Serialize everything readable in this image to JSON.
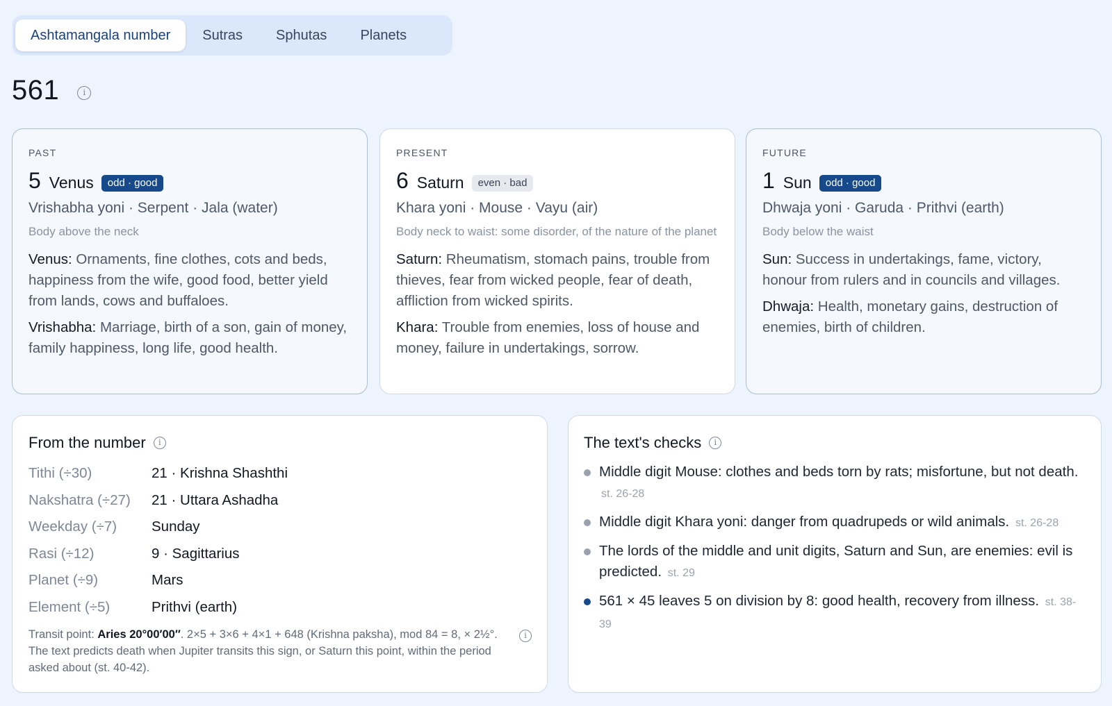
{
  "tabs": [
    {
      "label": "Ashtamangala number",
      "active": true
    },
    {
      "label": "Sutras",
      "active": false
    },
    {
      "label": "Sphutas",
      "active": false
    },
    {
      "label": "Planets",
      "active": false
    }
  ],
  "number": "561",
  "periods": [
    {
      "label": "PAST",
      "digit": "5",
      "planet": "Venus",
      "badge": "odd · good",
      "yoni": "Vrishabha yoni · Serpent · Jala (water)",
      "body": "Body above the neck",
      "desc": [
        {
          "key": "Venus:",
          "text": " Ornaments, fine clothes, cots and beds, happiness from the wife, good food, better yield from lands, cows and buffaloes."
        },
        {
          "key": "Vrishabha:",
          "text": " Marriage, birth of a son, gain of money, family happiness, long life, good health."
        }
      ]
    },
    {
      "label": "PRESENT",
      "digit": "6",
      "planet": "Saturn",
      "badge": "even · bad",
      "yoni": "Khara yoni · Mouse · Vayu (air)",
      "body": "Body neck to waist: some disorder, of the nature of the planet",
      "desc": [
        {
          "key": "Saturn:",
          "text": " Rheumatism, stomach pains, trouble from thieves, fear from wicked people, fear of death, affliction from wicked spirits."
        },
        {
          "key": "Khara:",
          "text": " Trouble from enemies, loss of house and money, failure in undertakings, sorrow."
        }
      ]
    },
    {
      "label": "FUTURE",
      "digit": "1",
      "planet": "Sun",
      "badge": "odd · good",
      "yoni": "Dhwaja yoni · Garuda · Prithvi (earth)",
      "body": "Body below the waist",
      "desc": [
        {
          "key": "Sun:",
          "text": " Success in undertakings, fame, victory, honour from rulers and in councils and villages."
        },
        {
          "key": "Dhwaja:",
          "text": " Health, monetary gains, destruction of enemies, birth of children."
        }
      ]
    }
  ],
  "from_number": {
    "title": "From the number",
    "rows": [
      {
        "key": "Tithi (÷30)",
        "value": "21 · Krishna Shashthi"
      },
      {
        "key": "Nakshatra (÷27)",
        "value": "21 · Uttara Ashadha"
      },
      {
        "key": "Weekday (÷7)",
        "value": "Sunday"
      },
      {
        "key": "Rasi (÷12)",
        "value": "9 · Sagittarius"
      },
      {
        "key": "Planet (÷9)",
        "value": "Mars"
      },
      {
        "key": "Element (÷5)",
        "value": "Prithvi (earth)"
      }
    ],
    "transit_prefix": "Transit point: ",
    "transit_bold": "Aries 20°00′00″",
    "transit_rest": ". 2×5 + 3×6 + 4×1 + 648 (Krishna paksha), mod 84 = 8, × 2½°. The text predicts death when Jupiter transits this sign, or Saturn this point, within the period asked about (st. 40-42)."
  },
  "checks": {
    "title": "The text's checks",
    "items": [
      {
        "text": "Middle digit Mouse: clothes and beds torn by rats; misfortune, but not death.",
        "ref": "st. 26-28",
        "color": "#9aa2ae"
      },
      {
        "text": "Middle digit Khara yoni: danger from quadrupeds or wild animals.",
        "ref": "st. 26-28",
        "color": "#9aa2ae"
      },
      {
        "text": "The lords of the middle and unit digits, Saturn and Sun, are enemies: evil is predicted.",
        "ref": "st. 29",
        "color": "#9aa2ae"
      },
      {
        "text": "561 × 45 leaves 5 on division by 8: good health, recovery from illness.",
        "ref": "st. 38-39",
        "color": "#174a8b"
      }
    ]
  },
  "icons": {
    "info": "info-icon"
  }
}
